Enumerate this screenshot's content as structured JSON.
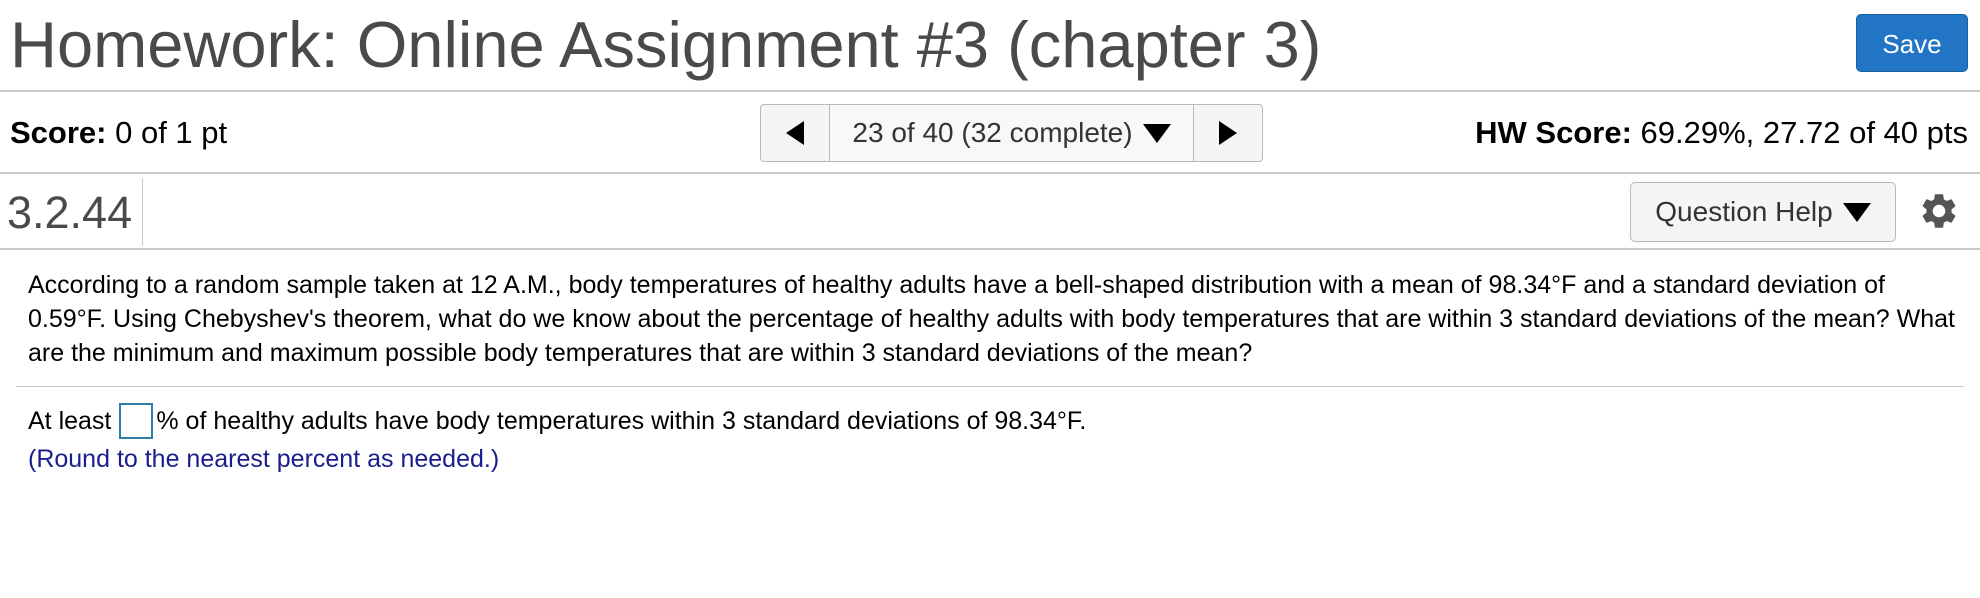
{
  "header": {
    "title": "Homework: Online Assignment #3 (chapter 3)",
    "save_label": "Save"
  },
  "score_bar": {
    "score_label": "Score:",
    "score_value": "0 of 1 pt",
    "navigator_label": "23 of 40 (32 complete)",
    "hw_score_label": "HW Score:",
    "hw_score_value": "69.29%, 27.72 of 40 pts"
  },
  "question_header": {
    "number": "3.2.44",
    "help_label": "Question Help"
  },
  "question": {
    "text": "According to a random sample taken at 12 A.M., body temperatures of healthy adults have a bell-shaped distribution with a mean of 98.34°F and a standard deviation of 0.59°F. Using Chebyshev's theorem, what do we know about the percentage of healthy adults with body temperatures that are within 3 standard deviations of the mean? What are the minimum and maximum possible body temperatures that are within 3 standard deviations of the mean?",
    "answer_prefix": "At least",
    "answer_value": "",
    "answer_suffix": "% of healthy adults have body temperatures within 3 standard deviations of 98.34°F.",
    "round_note": "(Round to the nearest percent as needed.)"
  },
  "icons": {
    "prev": "triangle-left-icon",
    "next": "triangle-right-icon",
    "dropdown": "caret-down-icon",
    "settings": "gear-icon"
  },
  "colors": {
    "save_button": "#2274c4",
    "title_text": "#4a4a4a",
    "input_border": "#2f7fa8",
    "note_text": "#1a1e8c",
    "divider": "#c8c8c8"
  }
}
